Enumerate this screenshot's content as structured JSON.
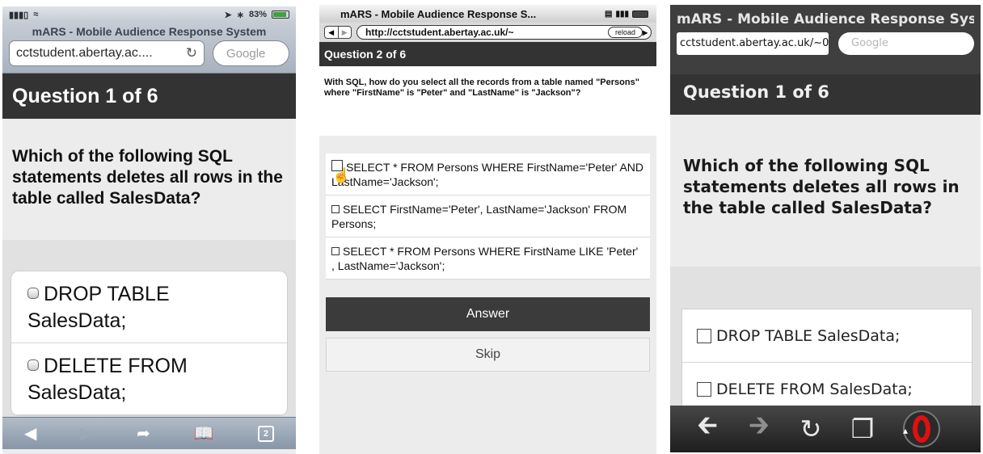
{
  "screens": [
    {
      "status": {
        "battery": "83%"
      },
      "title": "mARS - Mobile Audience Response System",
      "url": "cctstudent.abertay.ac....",
      "search_placeholder": "Google",
      "question_header": "Question 1 of 6",
      "question_text": "Which of the following SQL statements deletes all rows in the table called SalesData?",
      "options": [
        "DROP TABLE SalesData;",
        "DELETE FROM SalesData;"
      ],
      "toolbar": {
        "tabs_count": "2"
      }
    },
    {
      "title": "mARS - Mobile Audience Response S...",
      "url": "http://cctstudent.abertay.ac.uk/~",
      "reload_label": "reload",
      "question_header": "Question 2 of 6",
      "question_text": "With SQL, how do you select all the records from a table named \"Persons\" where \"FirstName\" is \"Peter\" and \"LastName\" is \"Jackson\"?",
      "options": [
        "SELECT * FROM Persons WHERE FirstName='Peter' AND LastName='Jackson';",
        "SELECT FirstName='Peter', LastName='Jackson' FROM Persons;",
        "SELECT * FROM Persons WHERE FirstName LIKE 'Peter' , LastName='Jackson';"
      ],
      "answer_label": "Answer",
      "skip_label": "Skip"
    },
    {
      "title": "mARS - Mobile Audience Response System",
      "url": "cctstudent.abertay.ac.uk/~0",
      "search_placeholder": "Google",
      "question_header": "Question 1 of 6",
      "question_text": "Which of the following SQL statements deletes all rows in the table called SalesData?",
      "options": [
        "DROP TABLE SalesData;",
        "DELETE FROM SalesData;"
      ]
    }
  ],
  "colors": {
    "header_bg": "#333333",
    "content_bg": "#ececec",
    "answer_bg": "#e1e1e1",
    "opera_red": "#e01010"
  }
}
